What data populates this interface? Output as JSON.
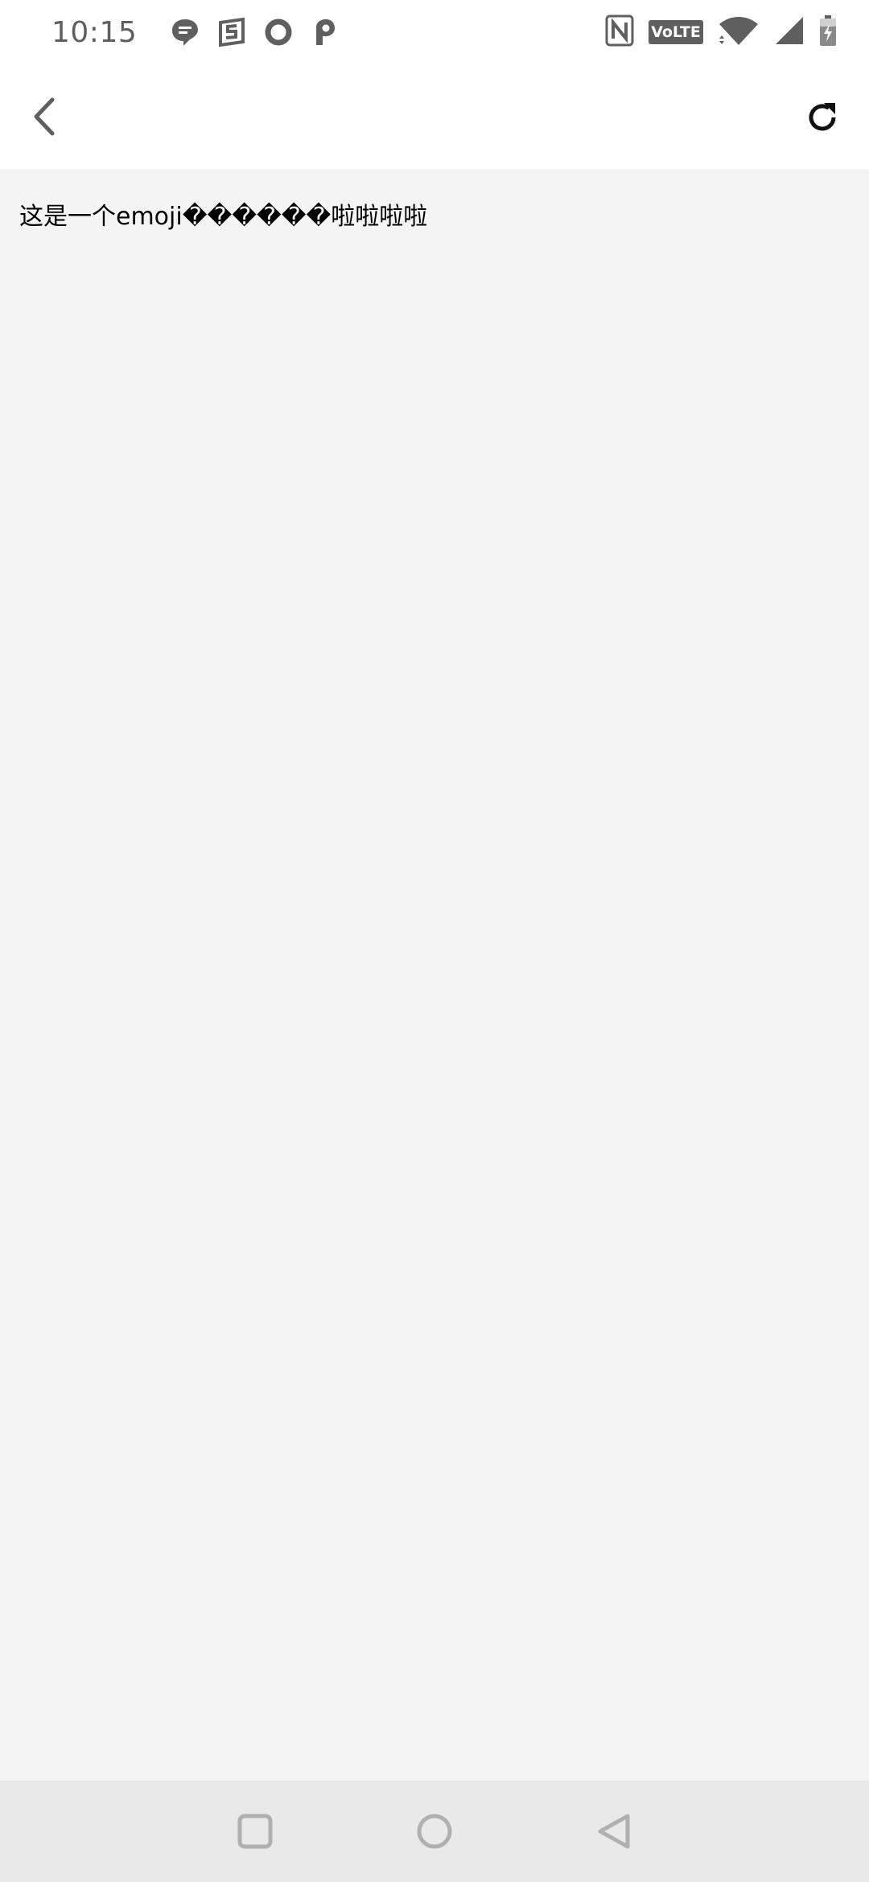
{
  "status_bar": {
    "time": "10:15",
    "notification_icons": [
      "chat-bubble-icon",
      "s-app-icon",
      "circle-app-icon",
      "p-app-icon"
    ],
    "right_icons": [
      "nfc-icon",
      "volte-icon",
      "wifi-icon",
      "signal-icon",
      "battery-charging-icon"
    ],
    "volte_label": "VoLTE"
  },
  "app_bar": {
    "back_icon": "chevron-left-icon",
    "refresh_icon": "refresh-icon"
  },
  "content": {
    "message": "这是一个emoji������啦啦啦啦"
  },
  "nav_bar": {
    "items": [
      "recents-square-icon",
      "home-circle-icon",
      "back-triangle-icon"
    ]
  },
  "colors": {
    "status_icon": "#5f5f5f",
    "content_bg": "#f4f4f4",
    "bar_bg": "#ffffff",
    "nav_bg": "#e9e9e9",
    "nav_icon": "#b0b0b0"
  }
}
